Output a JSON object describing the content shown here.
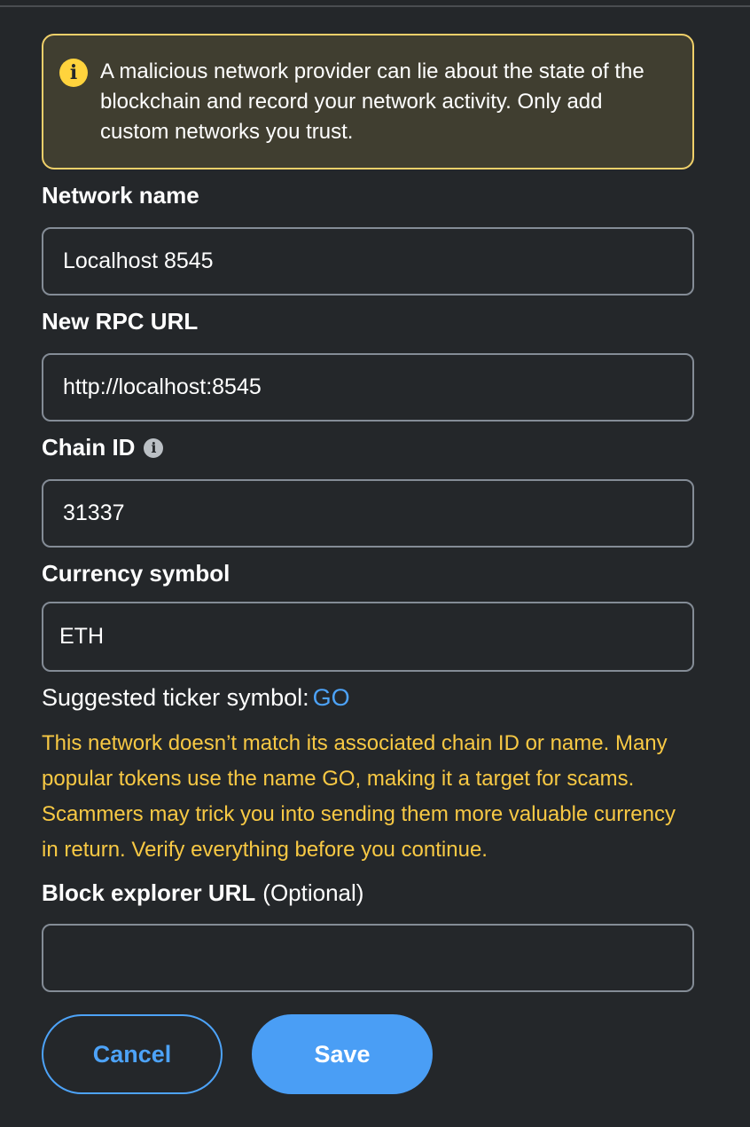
{
  "warning": {
    "icon": "info-icon",
    "text": "A malicious network provider can lie about the state of the blockchain and record your network activity. Only add custom networks you trust."
  },
  "fields": {
    "network_name": {
      "label": "Network name",
      "value": "Localhost 8545"
    },
    "rpc_url": {
      "label": "New RPC URL",
      "value": "http://localhost:8545"
    },
    "chain_id": {
      "label": "Chain ID",
      "value": "31337"
    },
    "currency_symbol": {
      "label": "Currency symbol",
      "value": "ETH"
    },
    "block_explorer": {
      "label": "Block explorer URL",
      "optional": "(Optional)",
      "value": ""
    }
  },
  "suggested": {
    "label": "Suggested ticker symbol:",
    "symbol": "GO"
  },
  "ticker_warning": "This network doesn’t match its associated chain ID or name. Many popular tokens use the name GO, making it a target for scams. Scammers may trick you into sending them more valuable currency in return. Verify everything before you continue.",
  "buttons": {
    "cancel": "Cancel",
    "save": "Save"
  },
  "colors": {
    "accent": "#4a9ef5",
    "warning": "#f8c944",
    "background": "#24272a"
  }
}
